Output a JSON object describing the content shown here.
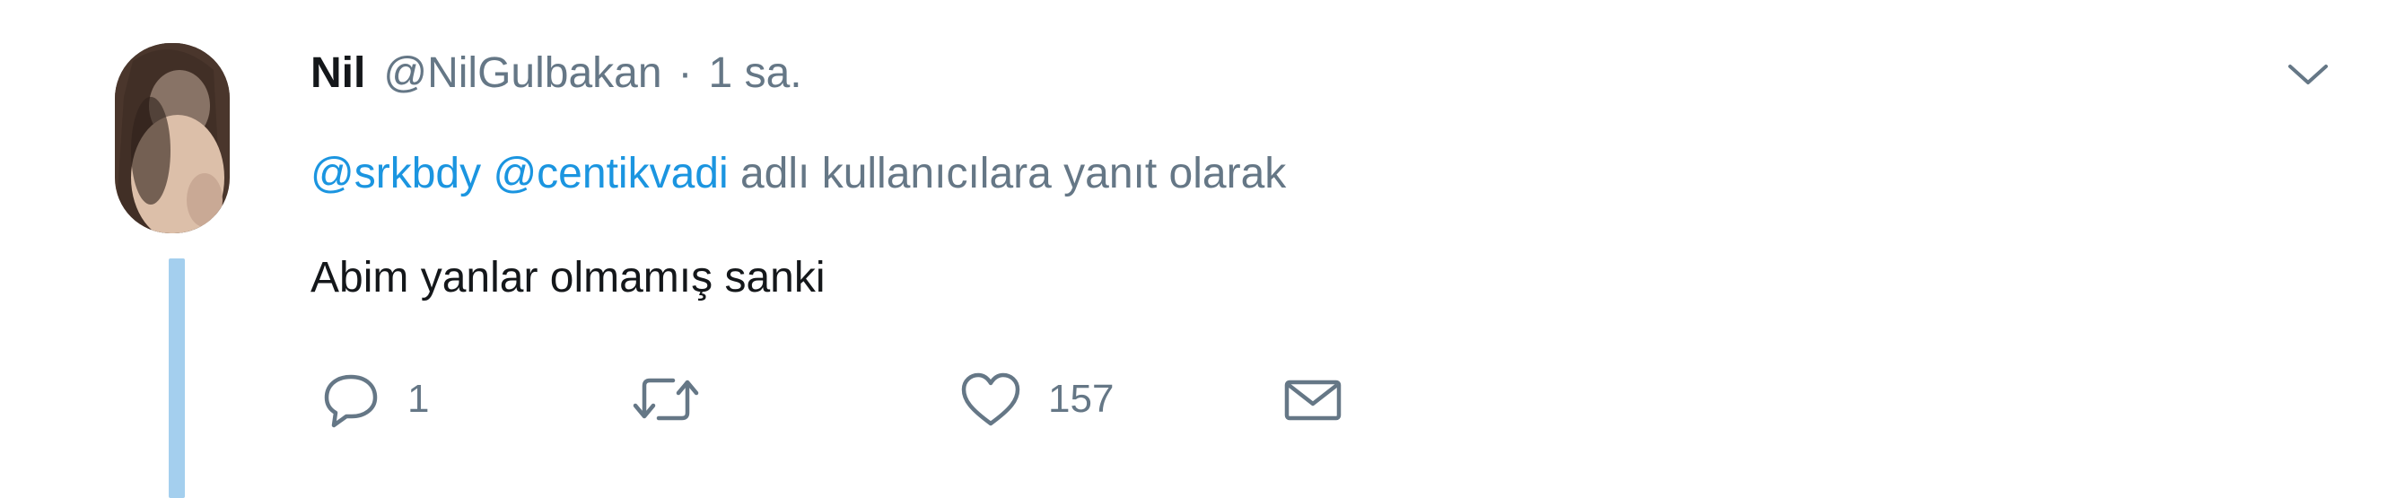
{
  "tweet": {
    "author_name": "Nil",
    "author_handle": "@NilGulbakan",
    "separator": "·",
    "time": "1 sa.",
    "reply_context": {
      "mentions": [
        "@srkbdy",
        "@centikvadi"
      ],
      "suffix": "adlı kullanıcılara yanıt olarak"
    },
    "text": "Abim yanlar olmamış sanki",
    "actions": {
      "reply_count": "1",
      "like_count": "157"
    }
  },
  "icons": {
    "caret": "chevron-down-icon",
    "reply": "reply-icon",
    "retweet": "retweet-icon",
    "like": "heart-icon",
    "dm": "envelope-icon"
  },
  "colors": {
    "link": "#1b95e0",
    "secondary_text": "#657786",
    "thread_line": "#a4cfee",
    "primary_text": "#14171a"
  }
}
